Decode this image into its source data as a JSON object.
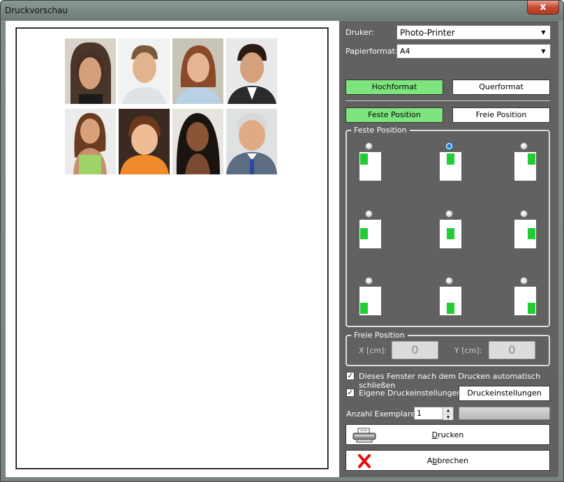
{
  "window": {
    "title": "Druckvorschau",
    "close_label": "x"
  },
  "printer": {
    "label": "Druker:",
    "value": "Photo-Printer"
  },
  "paper": {
    "label": "Papierformat:",
    "value": "A4"
  },
  "orientation": {
    "portrait": "Hochformat",
    "landscape": "Querformat",
    "selected": "portrait"
  },
  "positioning": {
    "fixed": "Feste Position",
    "free": "Freie Position",
    "selected": "fixed"
  },
  "fixed_position": {
    "legend": "Feste Position",
    "selected_index": 1
  },
  "free_position": {
    "legend": "Freie Position",
    "x_label": "X [cm]:",
    "x_value": "0",
    "y_label": "Y [cm]:",
    "y_value": "0"
  },
  "options": {
    "auto_close_label": "Dieses Fenster nach dem Drucken automatisch schließen",
    "auto_close_checked": true,
    "own_settings_label": "Eigene Druckeinstellungen",
    "own_settings_checked": true,
    "settings_button": "Druckeinstellungen"
  },
  "copies": {
    "label": "Anzahl Exemplare:",
    "value": "1"
  },
  "actions": {
    "print_label_rest": "rucken",
    "print_label_first": "D",
    "cancel_label_pre": "A",
    "cancel_label_u": "b",
    "cancel_label_rest": "brechen"
  },
  "colors": {
    "panel": "#616161",
    "accent_green": "#7ee57e",
    "icon_green": "#22cc33"
  }
}
